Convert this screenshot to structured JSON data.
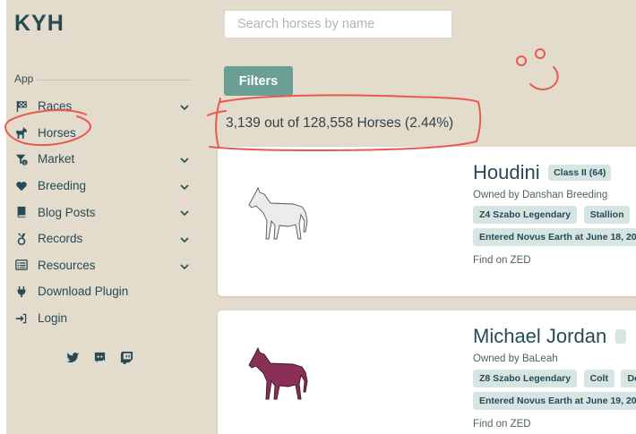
{
  "sidebar": {
    "logo": "KYH",
    "section": "App",
    "items": [
      {
        "label": "Races",
        "icon": "checkered-flag-icon",
        "expandable": true
      },
      {
        "label": "Horses",
        "icon": "horse-icon",
        "expandable": false
      },
      {
        "label": "Market",
        "icon": "funnel-dollar-icon",
        "expandable": true
      },
      {
        "label": "Breeding",
        "icon": "heart-icon",
        "expandable": true
      },
      {
        "label": "Blog Posts",
        "icon": "book-icon",
        "expandable": true
      },
      {
        "label": "Records",
        "icon": "medal-icon",
        "expandable": true
      },
      {
        "label": "Resources",
        "icon": "list-icon",
        "expandable": true
      },
      {
        "label": "Download Plugin",
        "icon": "plug-icon",
        "expandable": false
      },
      {
        "label": "Login",
        "icon": "sign-in-icon",
        "expandable": false
      }
    ],
    "socials": [
      "twitter-icon",
      "discord-icon",
      "twitch-icon"
    ]
  },
  "main": {
    "search_placeholder": "Search horses by name",
    "filters_label": "Filters",
    "count_text": "3,139 out of 128,558 Horses (2.44%)"
  },
  "horses": [
    {
      "name": "Houdini",
      "class": "Class II (64)",
      "owner": "Owned by Danshan Breeding",
      "tags": [
        "Z4 Szabo Legendary",
        "Stallion"
      ],
      "entered": "Entered Novus Earth at June 18, 20",
      "link": "Find on ZED",
      "coat_color": "#ececec"
    },
    {
      "name": "Michael Jordan",
      "class": "",
      "owner": "Owned by BaLeah",
      "tags": [
        "Z8 Szabo Legendary",
        "Colt",
        "De"
      ],
      "entered": "Entered Novus Earth at June 19, 20",
      "link": "Find on ZED",
      "coat_color": "#8a2f55"
    }
  ],
  "colors": {
    "background": "#e3dccc",
    "accent": "#6b9f95",
    "text": "#274a55",
    "annotation": "#e85a50"
  }
}
